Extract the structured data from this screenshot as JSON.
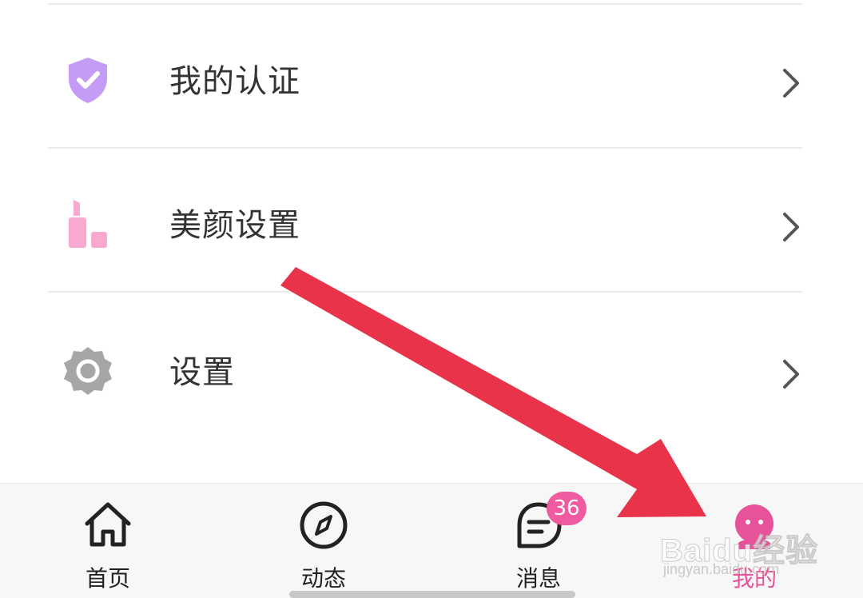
{
  "menu": {
    "items": [
      {
        "label": "我的认证",
        "icon": "verified-shield-icon"
      },
      {
        "label": "美颜设置",
        "icon": "lipstick-icon"
      },
      {
        "label": "设置",
        "icon": "gear-icon"
      }
    ]
  },
  "tabbar": {
    "tabs": [
      {
        "label": "首页",
        "icon": "home-icon"
      },
      {
        "label": "动态",
        "icon": "compass-icon"
      },
      {
        "label": "消息",
        "icon": "message-icon",
        "badge": "36"
      },
      {
        "label": "我的",
        "icon": "profile-icon",
        "active": true
      }
    ]
  },
  "watermark": {
    "main": "Baidu经验",
    "sub": "jingyan.baidu.com"
  },
  "colors": {
    "accent": "#e8529a",
    "badge": "#f05aa0",
    "annotation_arrow": "#e8334a",
    "shield": "#c49cf5",
    "lipstick": "#f7a9d0",
    "gear": "#a6a6a6"
  }
}
